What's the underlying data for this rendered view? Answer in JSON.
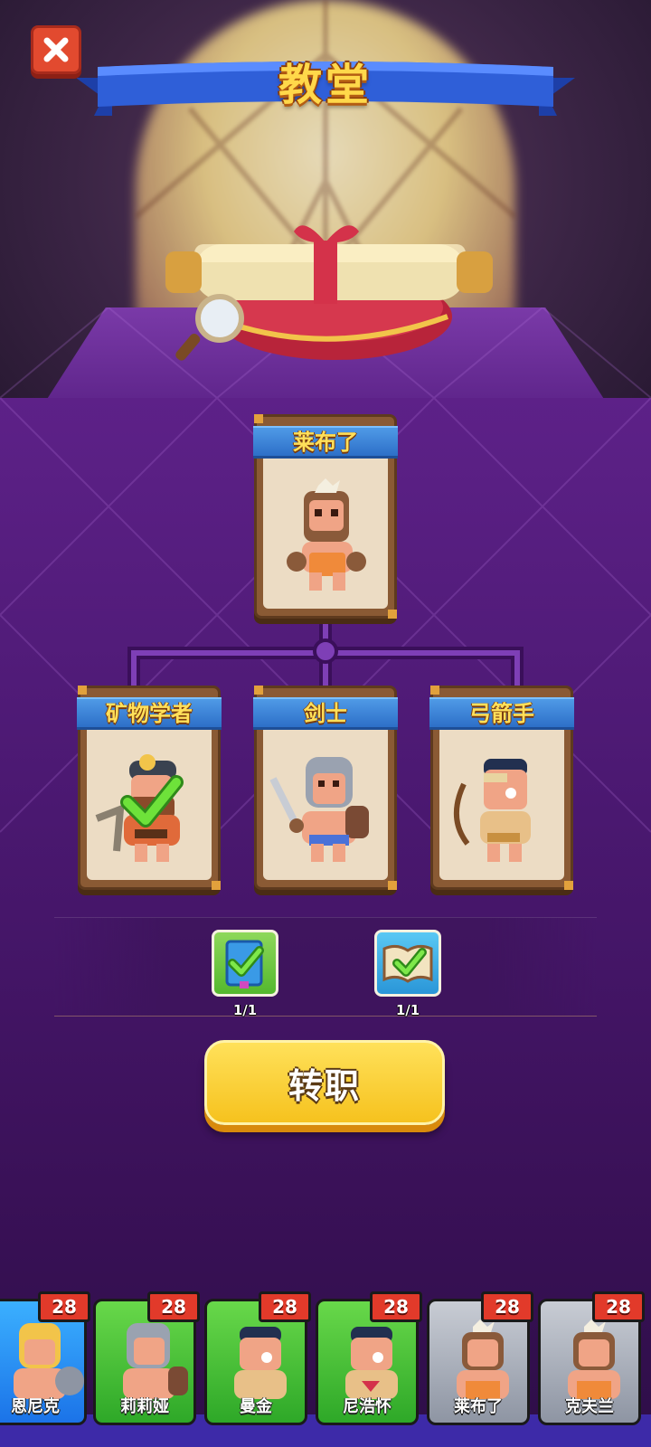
{
  "header": {
    "title": "教堂"
  },
  "tree": {
    "base_class": {
      "label": "莱布了"
    },
    "branches": [
      {
        "label": "矿物学者",
        "selected": true
      },
      {
        "label": "剑士",
        "selected": false
      },
      {
        "label": "弓箭手",
        "selected": false
      }
    ]
  },
  "requirements": [
    {
      "icon": "blue-book-icon",
      "count": "1/1",
      "completed": true
    },
    {
      "icon": "open-book-icon",
      "count": "1/1",
      "completed": true
    }
  ],
  "action": {
    "label": "转职"
  },
  "roster": [
    {
      "name": "恩尼克",
      "level": "28",
      "rarity": "blue"
    },
    {
      "name": "莉莉娅",
      "level": "28",
      "rarity": "green"
    },
    {
      "name": "曼金",
      "level": "28",
      "rarity": "green"
    },
    {
      "name": "尼浩怀",
      "level": "28",
      "rarity": "green"
    },
    {
      "name": "莱布了",
      "level": "28",
      "rarity": "gray"
    },
    {
      "name": "克夫兰",
      "level": "28",
      "rarity": "gray"
    }
  ],
  "colors": {
    "title_gold": "#ffd84a",
    "ribbon_blue": "#2f5fd8",
    "table_purple": "#5d2188",
    "button_yellow": "#f6c21e",
    "close_red": "#e24a2f",
    "check_green": "#4ccf2a"
  }
}
